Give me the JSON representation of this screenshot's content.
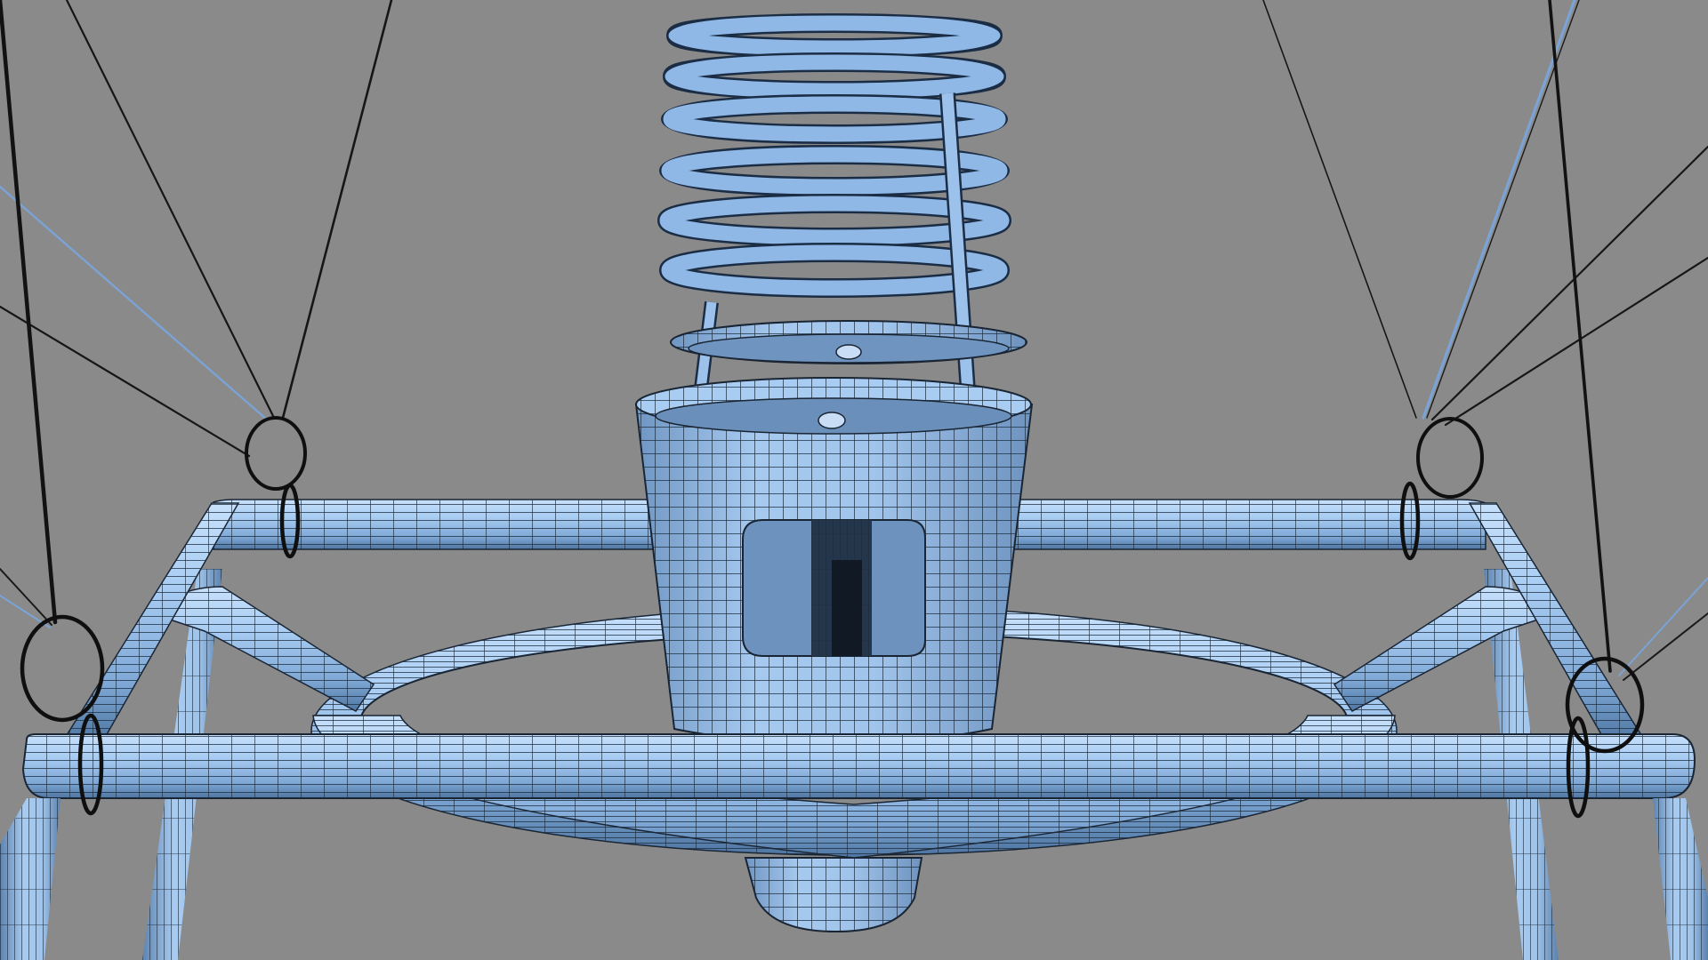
{
  "scene": {
    "background_color": "#8a8a8b",
    "model_color": "#9fc6f0",
    "model_shadow": "#5e86b3",
    "wire_color": "#111111",
    "cable_color": "#1a1a1a",
    "cable_highlight": "#8fb6e6"
  }
}
